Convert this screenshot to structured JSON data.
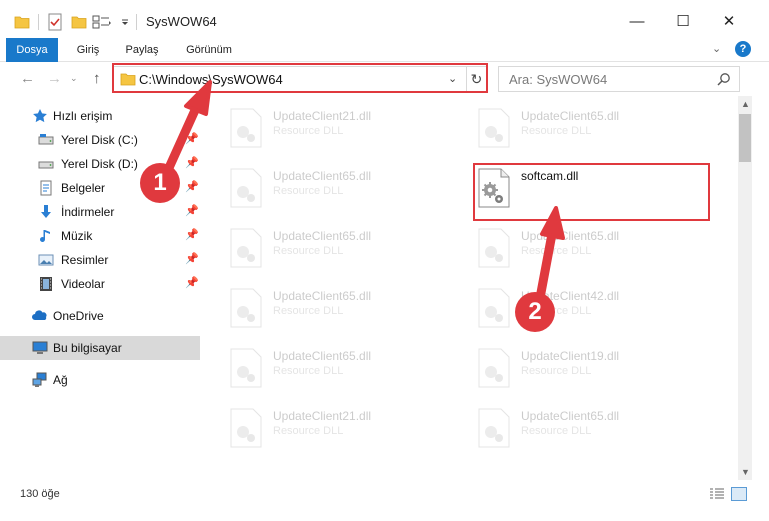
{
  "window": {
    "title": "SysWOW64",
    "min_glyph": "—",
    "max_glyph": "☐",
    "close_glyph": "✕"
  },
  "quick_access_toolbar": {
    "icons": [
      "folder-icon",
      "properties-icon",
      "new-folder-icon",
      "view-options-icon",
      "customize-dropdown-icon"
    ]
  },
  "ribbon": {
    "tabs": [
      "Dosya",
      "Giriş",
      "Paylaş",
      "Görünüm"
    ],
    "active_tab": "Dosya",
    "accent_color": "#1979ca",
    "expand_glyph": "⌄",
    "help_label": "?"
  },
  "nav": {
    "back_glyph": "←",
    "forward_glyph": "→",
    "recent_glyph": "⌄",
    "up_glyph": "↑",
    "address": "C:\\Windows\\SysWOW64",
    "address_dropdown_glyph": "⌄",
    "refresh_glyph": "↻",
    "search_placeholder": "Ara: SysWOW64"
  },
  "sidebar": {
    "quick_access_label": "Hızlı erişim",
    "items": [
      {
        "label": "Yerel Disk (C:)",
        "icon": "drive-c-icon",
        "pinned": true
      },
      {
        "label": "Yerel Disk (D:)",
        "icon": "drive-d-icon",
        "pinned": true
      },
      {
        "label": "Belgeler",
        "icon": "documents-icon",
        "pinned": true
      },
      {
        "label": "İndirmeler",
        "icon": "downloads-icon",
        "pinned": true
      },
      {
        "label": "Müzik",
        "icon": "music-icon",
        "pinned": true
      },
      {
        "label": "Resimler",
        "icon": "pictures-icon",
        "pinned": true
      },
      {
        "label": "Videolar",
        "icon": "videos-icon",
        "pinned": true
      }
    ],
    "onedrive_label": "OneDrive",
    "this_pc_label": "Bu bilgisayar",
    "network_label": "Ağ",
    "selected": "Bu bilgisayar"
  },
  "files": {
    "left_column": [
      {
        "name": "UpdateClient21.dll",
        "type": "Resource DLL"
      },
      {
        "name": "UpdateClient65.dll",
        "type": "Resource DLL"
      },
      {
        "name": "UpdateClient65.dll",
        "type": "Resource DLL"
      },
      {
        "name": "UpdateClient65.dll",
        "type": "Resource DLL"
      },
      {
        "name": "UpdateClient65.dll",
        "type": "Resource DLL"
      },
      {
        "name": "UpdateClient21.dll",
        "type": "Resource DLL"
      }
    ],
    "right_column": [
      {
        "name": "UpdateClient65.dll",
        "type": "Resource DLL"
      },
      {
        "name": "softcam.dll",
        "type": ""
      },
      {
        "name": "UpdateClient65.dll",
        "type": "Resource DLL"
      },
      {
        "name": "UpdateClient42.dll",
        "type": "Resource DLL"
      },
      {
        "name": "UpdateClient19.dll",
        "type": "Resource DLL"
      },
      {
        "name": "UpdateClient65.dll",
        "type": "Resource DLL"
      }
    ],
    "highlighted_file": "softcam.dll"
  },
  "status": {
    "item_count": "130 öğe"
  },
  "annotations": {
    "step1": "1",
    "step2": "2",
    "highlight_color": "#e0393e"
  }
}
